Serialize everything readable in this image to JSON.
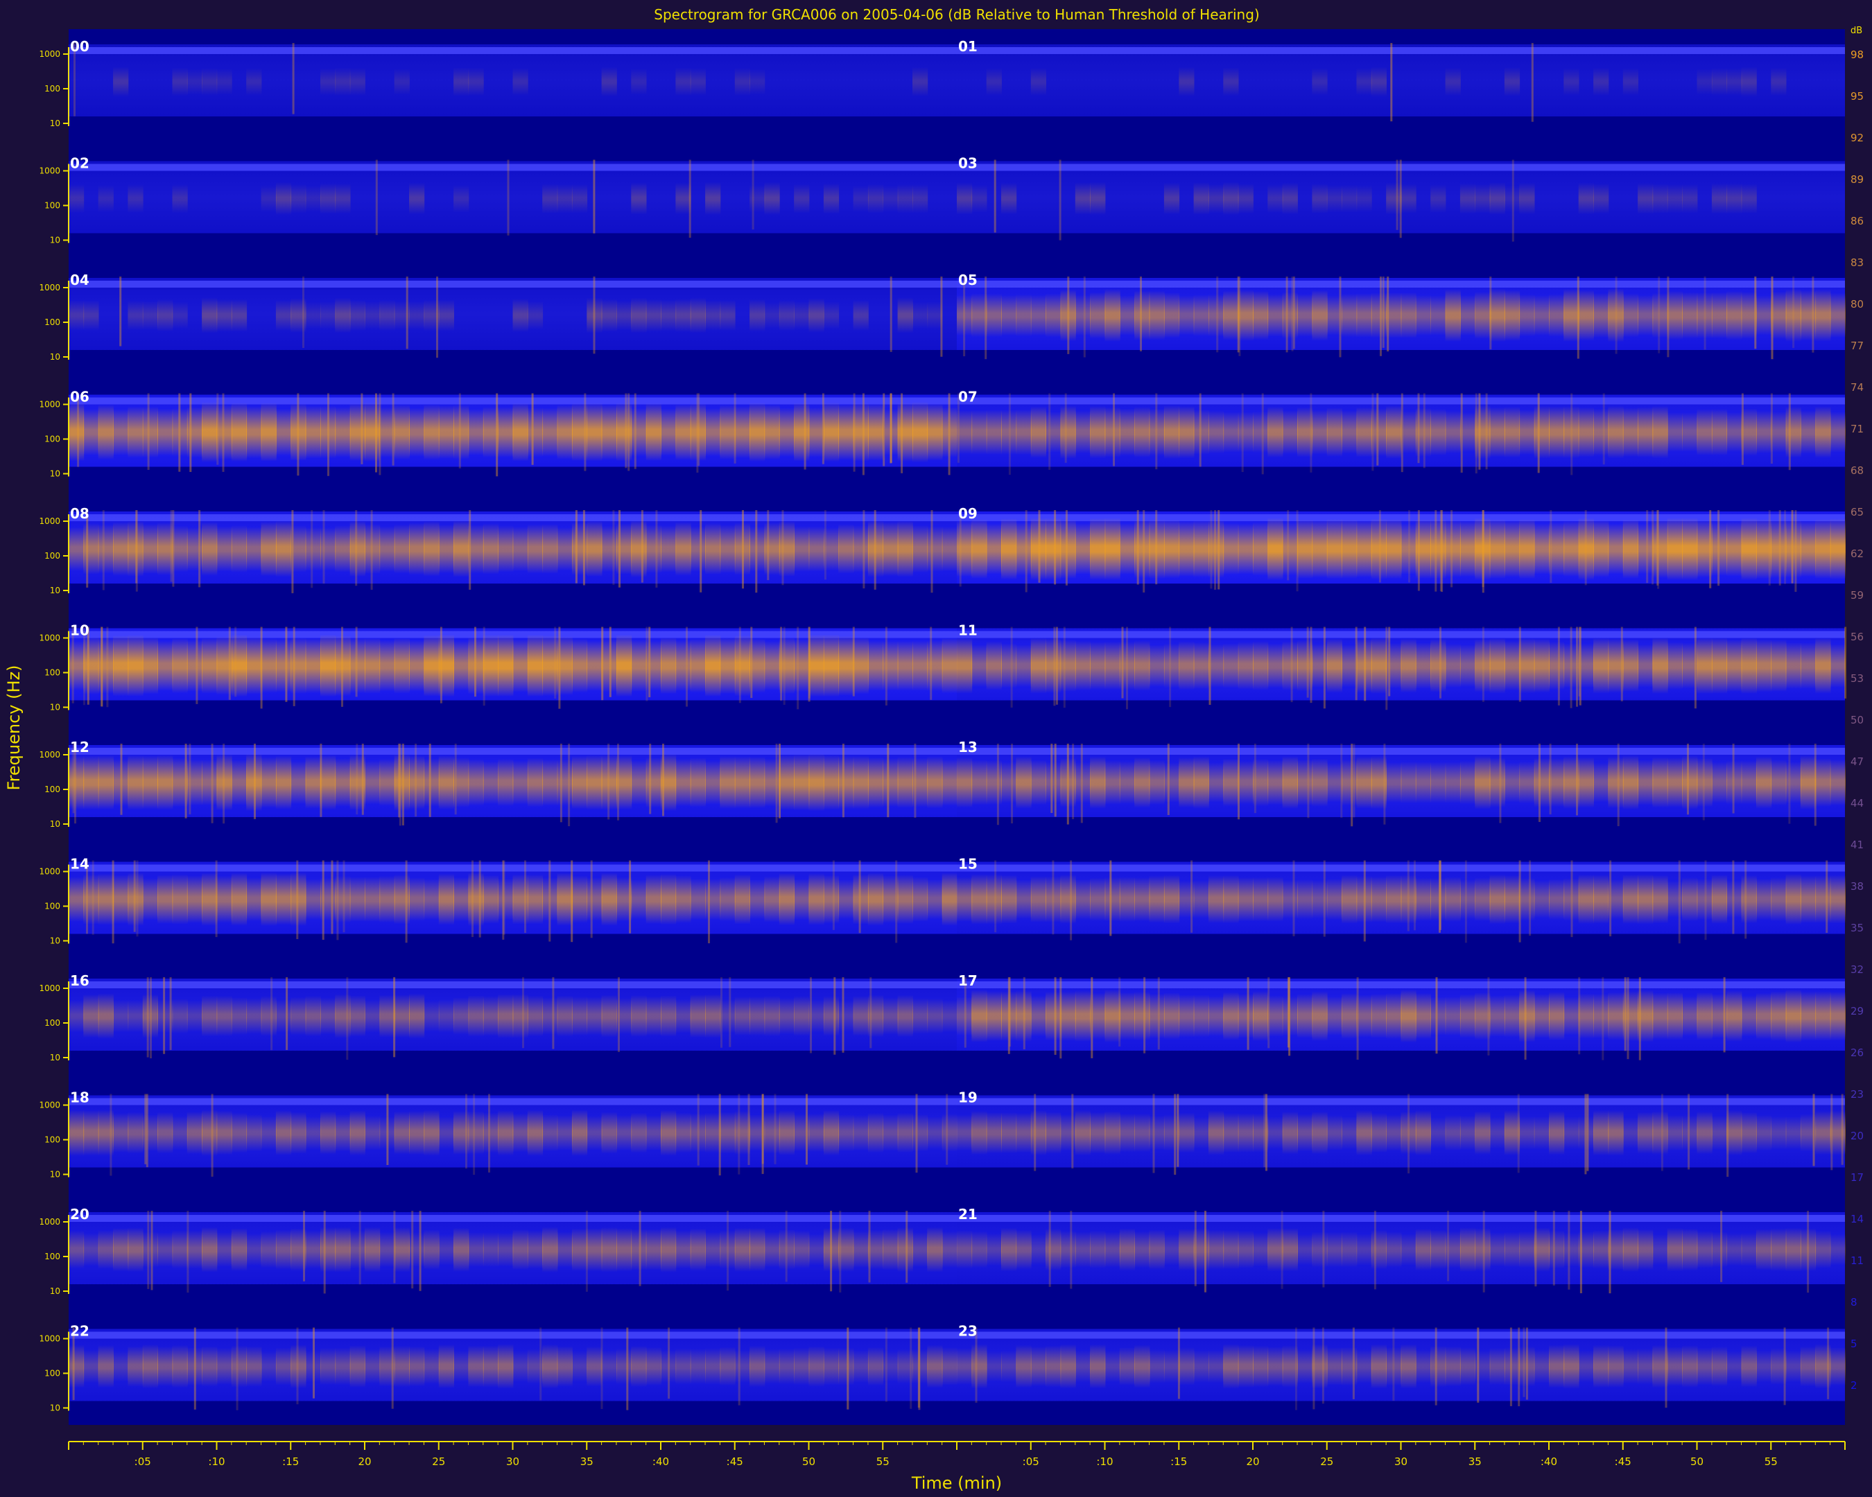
{
  "chart_data": {
    "type": "heatmap",
    "title": "Spectrogram for GRCA006 on 2005-04-06 (dB Relative to Human Threshold of Hearing)",
    "xlabel": "Time (min)",
    "ylabel": "Frequency (Hz)",
    "x_ticks": [
      ":05",
      ":10",
      ":15",
      "20",
      "25",
      "30",
      "35",
      ":40",
      ":45",
      "50",
      "55"
    ],
    "x_range_minutes": [
      0,
      60
    ],
    "y_ticks": [
      "1000",
      "100",
      "10"
    ],
    "y_scale": "log",
    "colorbar": {
      "label": "dB",
      "ticks": [
        98,
        95,
        92,
        89,
        86,
        83,
        80,
        77,
        74,
        71,
        68,
        65,
        62,
        59,
        56,
        53,
        50,
        47,
        44,
        41,
        38,
        35,
        32,
        29,
        26,
        23,
        20,
        17,
        14,
        11,
        8,
        5,
        2
      ],
      "range": [
        0,
        100
      ],
      "low_color": "#1010e8",
      "high_color": "#f0a020"
    },
    "panels_per_row": 2,
    "hours": [
      {
        "label": "00",
        "level": 0.05
      },
      {
        "label": "01",
        "level": 0.05
      },
      {
        "label": "02",
        "level": 0.12
      },
      {
        "label": "03",
        "level": 0.12
      },
      {
        "label": "04",
        "level": 0.18
      },
      {
        "label": "05",
        "level": 0.62
      },
      {
        "label": "06",
        "level": 0.78
      },
      {
        "label": "07",
        "level": 0.62
      },
      {
        "label": "08",
        "level": 0.7
      },
      {
        "label": "09",
        "level": 0.88
      },
      {
        "label": "10",
        "level": 0.85
      },
      {
        "label": "11",
        "level": 0.68
      },
      {
        "label": "12",
        "level": 0.7
      },
      {
        "label": "13",
        "level": 0.62
      },
      {
        "label": "14",
        "level": 0.62
      },
      {
        "label": "15",
        "level": 0.55
      },
      {
        "label": "16",
        "level": 0.42
      },
      {
        "label": "17",
        "level": 0.6
      },
      {
        "label": "18",
        "level": 0.45
      },
      {
        "label": "19",
        "level": 0.42
      },
      {
        "label": "20",
        "level": 0.42
      },
      {
        "label": "21",
        "level": 0.4
      },
      {
        "label": "22",
        "level": 0.4
      },
      {
        "label": "23",
        "level": 0.4
      }
    ]
  },
  "colors": {
    "background": "#1a0f3a",
    "plot_background": "#00008c",
    "axis": "#f0e000",
    "title": "#f0e000",
    "hour_label": "#ffffff"
  }
}
